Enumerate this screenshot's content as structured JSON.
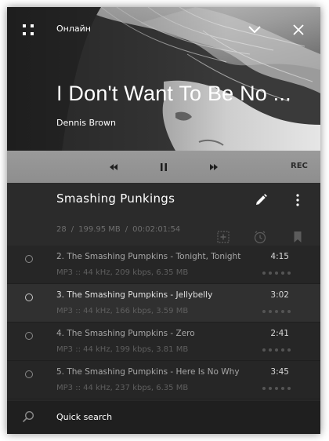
{
  "topbar": {
    "title": "Онлайн",
    "menu_icon": "grid-menu-icon",
    "collapse_icon": "chevron-down-icon",
    "close_icon": "close-icon"
  },
  "now_playing": {
    "title": "I Don't Want To Be No ...",
    "artist": "Dennis Brown"
  },
  "transport": {
    "prev_icon": "previous-icon",
    "pause_icon": "pause-icon",
    "next_icon": "next-icon",
    "rec_label": "REC"
  },
  "playlist": {
    "name": "Smashing Punkings",
    "count": "28",
    "size": "199.95 MB",
    "duration": "00:02:01:54",
    "separator": "/",
    "icons": [
      "edit-icon",
      "more-vertical-icon",
      "add-to-playlist-icon",
      "timer-icon",
      "bookmark-icon"
    ]
  },
  "tracks": [
    {
      "title": "2. The Smashing Pumpkins - Tonight, Tonight",
      "duration": "4:15",
      "info": "MP3 :: 44 kHz, 209 kbps, 6.35 MB",
      "active": false
    },
    {
      "title": "3. The Smashing Pumpkins - Jellybelly",
      "duration": "3:02",
      "info": "MP3 :: 44 kHz, 166 kbps, 3.59 MB",
      "active": true
    },
    {
      "title": "4. The Smashing Pumpkins - Zero",
      "duration": "2:41",
      "info": "MP3 :: 44 kHz, 199 kbps, 3.81 MB",
      "active": false
    },
    {
      "title": "5. The Smashing Pumpkins - Here Is No Why",
      "duration": "3:45",
      "info": "MP3 :: 44 kHz, 237 kbps, 6.35 MB",
      "active": false
    }
  ],
  "search": {
    "label": "Quick search",
    "icon": "search-icon"
  },
  "colors": {
    "background": "#282828",
    "transport_bar": "#9a9a9a",
    "search_bar": "#1f1f1f",
    "text_primary": "#ffffff",
    "text_muted": "#6e6e6e"
  }
}
